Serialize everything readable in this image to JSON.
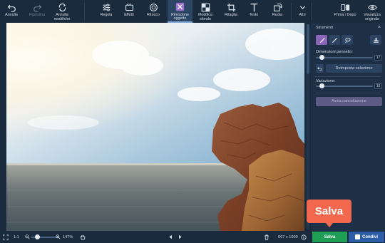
{
  "toolbar": {
    "undo": "Annulla",
    "redo": "Ripristina",
    "cancel_changes_line1": "Annulla",
    "cancel_changes_line2": "modifiche",
    "adjust": "Regola",
    "effects": "Effetti",
    "retouch": "Ritocco",
    "object_removal_line1": "Rimozione",
    "object_removal_line2": "oggetto",
    "change_bg_line1": "Modifica",
    "change_bg_line2": "sfondo",
    "crop": "Ritaglia",
    "text": "Testo",
    "rotate": "Ruota",
    "more": "Altri",
    "before_after": "Prima / Dopo",
    "original_view_line1": "Visualizza",
    "original_view_line2": "originale",
    "active_tool": "Rimozione oggetto"
  },
  "panel": {
    "title": "Strumenti",
    "close": "×",
    "brush_size_label": "Dimensioni pennello:",
    "brush_size_value": "17",
    "brush_size_fraction": 0.07,
    "reset_selection": "Reimposta selezione",
    "variation_label": "Variazione:",
    "variation_value": "15",
    "variation_fraction": 0.07,
    "start_removal": "Avvia cancellazione",
    "tools": [
      "brush-icon",
      "magic-wand-icon",
      "lasso-icon",
      "stamp-icon"
    ]
  },
  "bottombar": {
    "ratio": "1:1",
    "zoom": "147%",
    "dimensions": "667 x 1000",
    "save": "Salva",
    "share": "Condivi"
  },
  "callout": {
    "text": "Salva"
  },
  "colors": {
    "background": "#1b2b3e",
    "save": "#1f9e55",
    "share": "#2d5da8",
    "callout": "#f2684e",
    "active_tool": "#8a64b8"
  }
}
